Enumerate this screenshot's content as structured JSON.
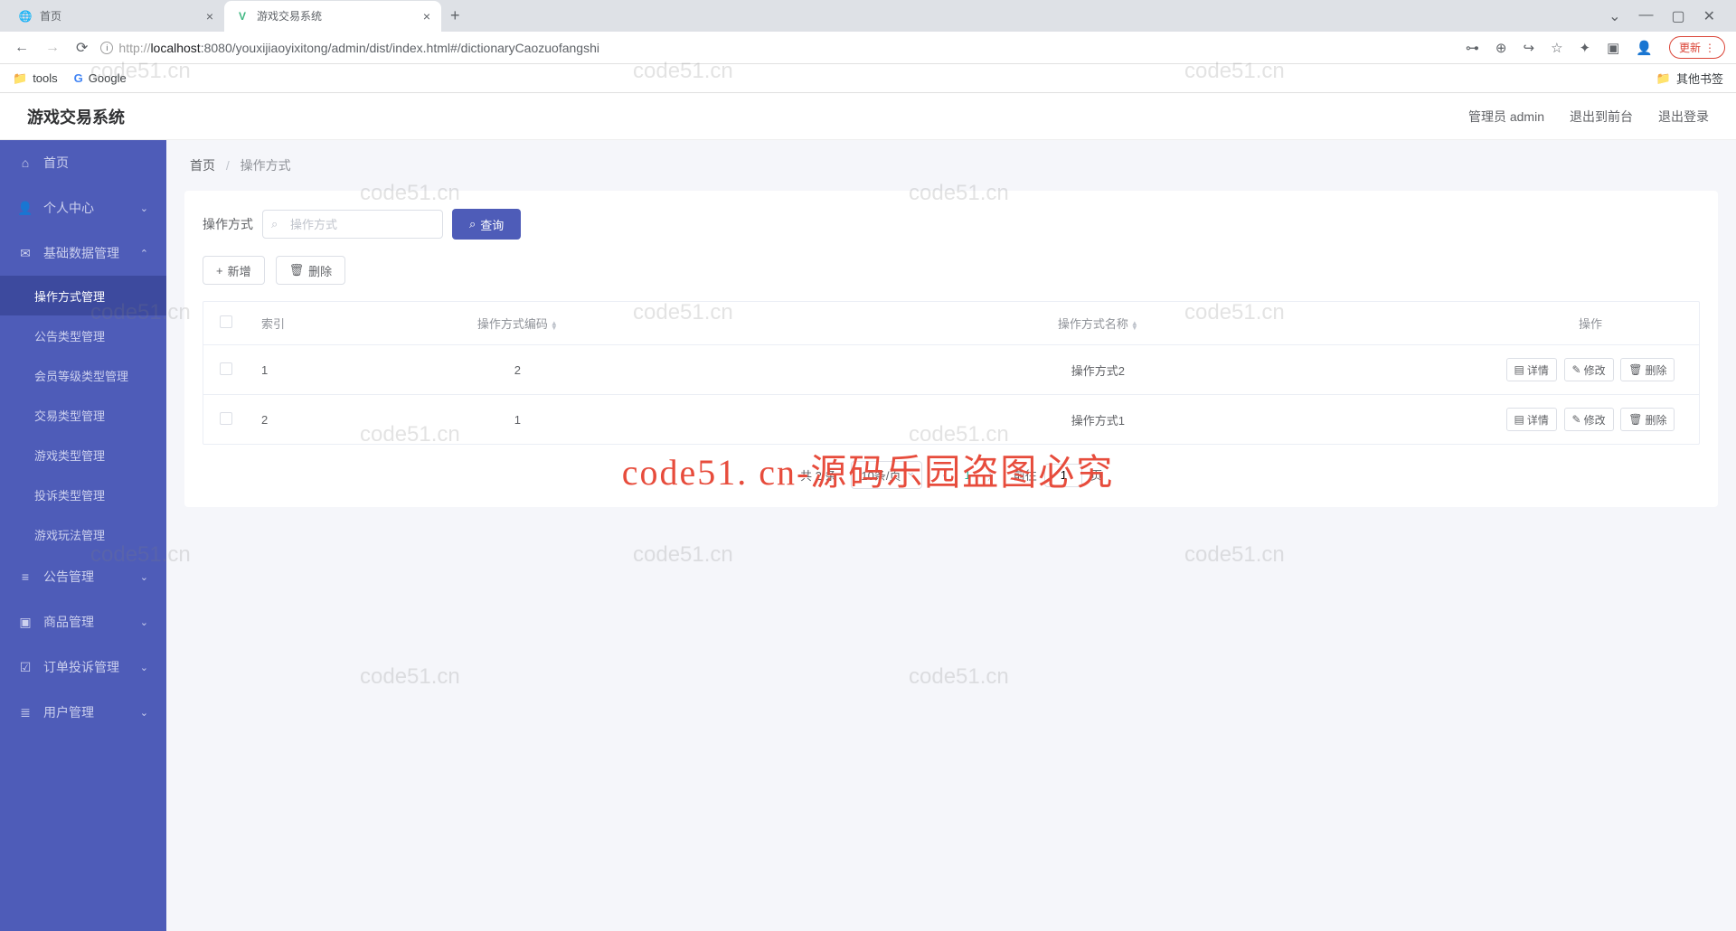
{
  "browser": {
    "tabs": [
      {
        "title": "首页",
        "favicon": "globe"
      },
      {
        "title": "游戏交易系统",
        "favicon": "vue"
      }
    ],
    "newtab_tooltip": "New tab",
    "window": {
      "dropdown": "⌄",
      "min": "—",
      "max": "▢",
      "close": "✕"
    },
    "nav": {
      "back": "←",
      "forward": "→",
      "reload": "⟳"
    },
    "url": {
      "prefix": "http://",
      "host": "localhost",
      "port": ":8080",
      "path": "/youxijiaoyixitong/admin/dist/index.html#/dictionaryCaozuofangshi"
    },
    "addr_icons": {
      "key": "⊶",
      "zoom": "⊕",
      "share": "↪",
      "star": "☆",
      "ext": "✦",
      "panel": "▣",
      "profile": "👤"
    },
    "update_btn": "更新",
    "bookmarks": {
      "tools": "tools",
      "google": "Google",
      "other": "其他书签"
    }
  },
  "app": {
    "title": "游戏交易系统",
    "header": {
      "user": "管理员 admin",
      "to_front": "退出到前台",
      "logout": "退出登录"
    }
  },
  "sidebar": {
    "items": [
      {
        "icon": "⌂",
        "label": "首页",
        "type": "item"
      },
      {
        "icon": "👤",
        "label": "个人中心",
        "type": "group",
        "open": false
      },
      {
        "icon": "✉",
        "label": "基础数据管理",
        "type": "group",
        "open": true,
        "children": [
          {
            "label": "操作方式管理",
            "active": true
          },
          {
            "label": "公告类型管理"
          },
          {
            "label": "会员等级类型管理"
          },
          {
            "label": "交易类型管理"
          },
          {
            "label": "游戏类型管理"
          },
          {
            "label": "投诉类型管理"
          },
          {
            "label": "游戏玩法管理"
          }
        ]
      },
      {
        "icon": "≡",
        "label": "公告管理",
        "type": "group",
        "open": false
      },
      {
        "icon": "▣",
        "label": "商品管理",
        "type": "group",
        "open": false
      },
      {
        "icon": "☑",
        "label": "订单投诉管理",
        "type": "group",
        "open": false
      },
      {
        "icon": "≣",
        "label": "用户管理",
        "type": "group",
        "open": false
      }
    ]
  },
  "breadcrumb": {
    "home": "首页",
    "current": "操作方式"
  },
  "filter": {
    "label": "操作方式",
    "placeholder": "操作方式",
    "query_btn": "查询"
  },
  "actions": {
    "add": "新增",
    "delete": "删除"
  },
  "table": {
    "headers": {
      "index": "索引",
      "code": "操作方式编码",
      "name": "操作方式名称",
      "ops": "操作"
    },
    "rows": [
      {
        "index": "1",
        "code": "2",
        "name": "操作方式2"
      },
      {
        "index": "2",
        "code": "1",
        "name": "操作方式1"
      }
    ],
    "row_ops": {
      "detail": "详情",
      "edit": "修改",
      "delete": "删除"
    }
  },
  "pagination": {
    "total": "共 2 条",
    "page_size": "10条/页",
    "current": "1",
    "jumper_prefix": "前往",
    "jumper_value": "1",
    "jumper_suffix": "页"
  },
  "watermark": {
    "small": "code51.cn",
    "center": "code51. cn-源码乐园盗图必究"
  }
}
